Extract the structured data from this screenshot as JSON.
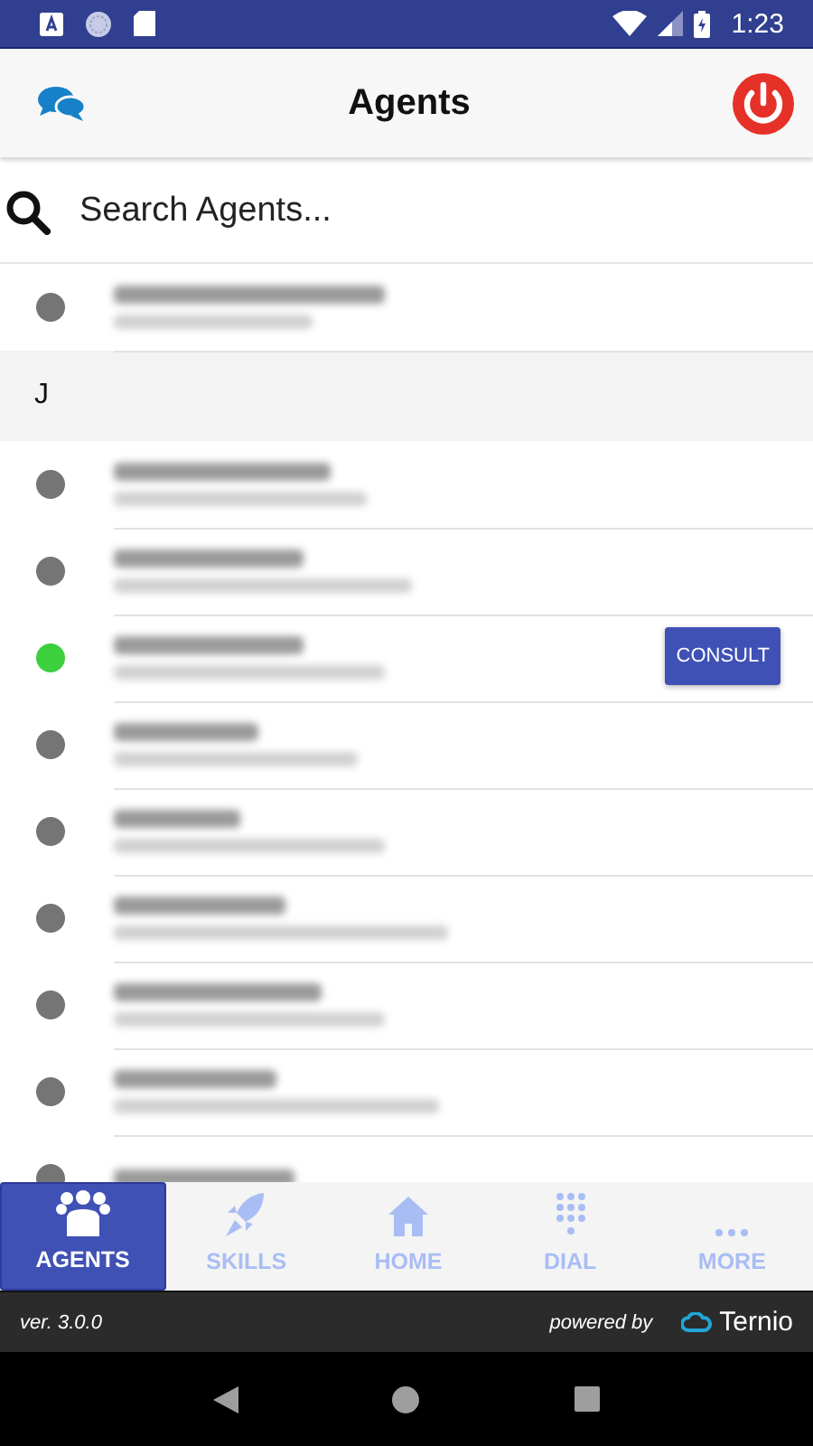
{
  "status_bar": {
    "time": "1:23"
  },
  "header": {
    "title": "Agents"
  },
  "search": {
    "placeholder": "Search Agents..."
  },
  "agents": [
    {
      "kind": "agent",
      "online": false
    },
    {
      "kind": "section",
      "letter": "J"
    },
    {
      "kind": "agent",
      "online": false
    },
    {
      "kind": "agent",
      "online": false
    },
    {
      "kind": "agent",
      "online": true,
      "action": "CONSULT"
    },
    {
      "kind": "agent",
      "online": false
    },
    {
      "kind": "agent",
      "online": false
    },
    {
      "kind": "agent",
      "online": false
    },
    {
      "kind": "agent",
      "online": false
    },
    {
      "kind": "agent",
      "online": false
    },
    {
      "kind": "agent",
      "online": false
    }
  ],
  "tabs": [
    {
      "label": "AGENTS",
      "selected": true
    },
    {
      "label": "SKILLS",
      "selected": false
    },
    {
      "label": "HOME",
      "selected": false
    },
    {
      "label": "DIAL",
      "selected": false
    },
    {
      "label": "MORE",
      "selected": false
    }
  ],
  "footer": {
    "version": "ver. 3.0.0",
    "powered_by": "powered by",
    "brand": "Ternio"
  }
}
